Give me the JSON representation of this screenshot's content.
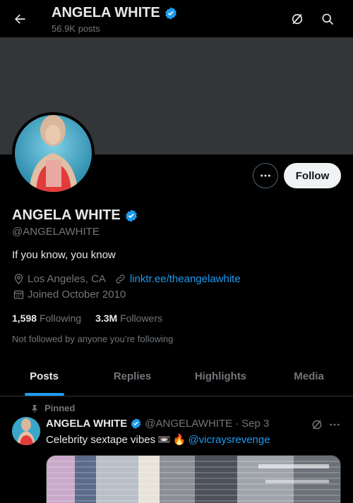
{
  "header": {
    "title": "ANGELA WHITE",
    "post_count": "56.9K posts"
  },
  "profile": {
    "display_name": "ANGELA WHITE",
    "handle": "@ANGELAWHITE",
    "bio": "If you know, you know",
    "location": "Los Angeles, CA",
    "website": "linktr.ee/theangelawhite",
    "joined": "Joined October 2010",
    "following_count": "1,598",
    "following_label": "Following",
    "followers_count": "3.3M",
    "followers_label": "Followers",
    "not_followed": "Not followed by anyone you’re following",
    "follow_label": "Follow"
  },
  "tabs": [
    {
      "label": "Posts",
      "active": true
    },
    {
      "label": "Replies",
      "active": false
    },
    {
      "label": "Highlights",
      "active": false
    },
    {
      "label": "Media",
      "active": false
    }
  ],
  "post": {
    "pinned_label": "Pinned",
    "author": "ANGELA WHITE",
    "handle": "@ANGELAWHITE",
    "separator": "·",
    "date": "Sep 3",
    "text": "Celebrity sextape vibes",
    "emoji_1": "📼",
    "emoji_2": "🔥",
    "mention": "@vicraysrevenge"
  },
  "colors": {
    "accent": "#1d9bf0",
    "verified": "#1d9bf0",
    "background": "#000000",
    "banner": "#333639"
  },
  "icons": [
    "back-arrow-icon",
    "verified-badge-icon",
    "grok-icon",
    "search-icon",
    "more-icon",
    "location-icon",
    "link-icon",
    "calendar-icon",
    "pin-icon"
  ]
}
